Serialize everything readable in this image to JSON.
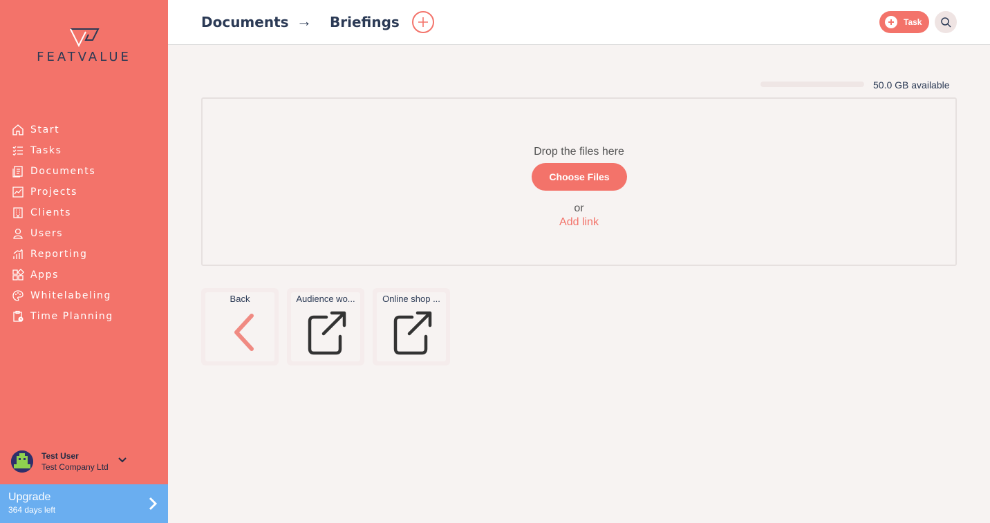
{
  "sidebar": {
    "logo_text": "FEATVALUE",
    "items": [
      {
        "label": "Start",
        "icon": "home-icon"
      },
      {
        "label": "Tasks",
        "icon": "tasks-icon"
      },
      {
        "label": "Documents",
        "icon": "documents-icon"
      },
      {
        "label": "Projects",
        "icon": "projects-icon"
      },
      {
        "label": "Clients",
        "icon": "building-icon"
      },
      {
        "label": "Users",
        "icon": "user-icon"
      },
      {
        "label": "Reporting",
        "icon": "chart-icon"
      },
      {
        "label": "Apps",
        "icon": "apps-icon"
      },
      {
        "label": "Whitelabeling",
        "icon": "palette-icon"
      },
      {
        "label": "Time Planning",
        "icon": "clipboard-clock-icon"
      }
    ],
    "user": {
      "name": "Test User",
      "company": "Test Company Ltd"
    },
    "upgrade": {
      "title": "Upgrade",
      "subtitle": "364 days left"
    }
  },
  "header": {
    "breadcrumb": [
      "Documents",
      "Briefings"
    ],
    "breadcrumb_separator": "→",
    "task_button_label": "Task"
  },
  "storage": {
    "available_text": "50.0 GB available"
  },
  "dropzone": {
    "drop_text": "Drop the files here",
    "choose_files_label": "Choose Files",
    "or_text": "or",
    "add_link_label": "Add link"
  },
  "tiles": [
    {
      "label": "Back",
      "icon": "chevron-left-icon"
    },
    {
      "label": "Audience wo...",
      "icon": "external-link-icon"
    },
    {
      "label": "Online shop ...",
      "icon": "external-link-icon"
    }
  ],
  "colors": {
    "brand": "#f3736a",
    "upgrade": "#6aaef0",
    "text": "#2b3a55"
  }
}
